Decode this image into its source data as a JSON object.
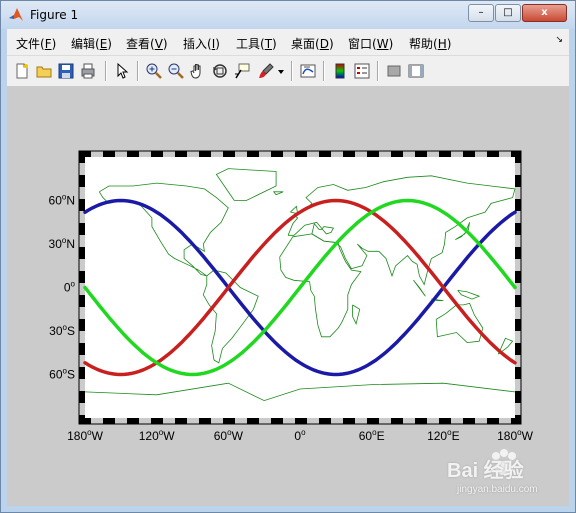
{
  "window": {
    "title": "Figure 1"
  },
  "window_controls": {
    "minimize": "–",
    "maximize": "□",
    "close": "x"
  },
  "menu": {
    "items": [
      {
        "label": "文件(",
        "key": "F",
        "end": ")"
      },
      {
        "label": "编辑(",
        "key": "E",
        "end": ")"
      },
      {
        "label": "查看(",
        "key": "V",
        "end": ")"
      },
      {
        "label": "插入(",
        "key": "I",
        "end": ")"
      },
      {
        "label": "工具(",
        "key": "T",
        "end": ")"
      },
      {
        "label": "桌面(",
        "key": "D",
        "end": ")"
      },
      {
        "label": "窗口(",
        "key": "W",
        "end": ")"
      },
      {
        "label": "帮助(",
        "key": "H",
        "end": ")"
      }
    ],
    "dock_arrow": "↘"
  },
  "toolbar": {
    "buttons": [
      "new-figure-icon",
      "open-file-icon",
      "save-icon",
      "print-icon",
      "edit-plot-arrow-icon",
      "zoom-in-icon",
      "zoom-out-icon",
      "pan-hand-icon",
      "rotate-3d-icon",
      "data-cursor-icon",
      "brush-icon",
      "brush-dropdown-icon",
      "link-plot-icon",
      "colorbar-icon",
      "legend-icon",
      "hide-plot-tools-icon",
      "show-plot-tools-icon"
    ]
  },
  "chart_data": {
    "type": "line",
    "projection": "equidistant cylindrical (world map)",
    "xlim": [
      -180,
      180
    ],
    "ylim": [
      -90,
      90
    ],
    "x_ticks": [
      {
        "value": -180,
        "label_num": "180",
        "label_dir": "W"
      },
      {
        "value": -120,
        "label_num": "120",
        "label_dir": "W"
      },
      {
        "value": -60,
        "label_num": "60",
        "label_dir": "W"
      },
      {
        "value": 0,
        "label_num": "0",
        "label_dir": ""
      },
      {
        "value": 60,
        "label_num": "60",
        "label_dir": "E"
      },
      {
        "value": 120,
        "label_num": "120",
        "label_dir": "E"
      },
      {
        "value": 180,
        "label_num": "180",
        "label_dir": "W"
      }
    ],
    "y_ticks": [
      {
        "value": 60,
        "label_num": "60",
        "label_dir": "N"
      },
      {
        "value": 30,
        "label_num": "30",
        "label_dir": "N"
      },
      {
        "value": 0,
        "label_num": "0",
        "label_dir": ""
      },
      {
        "value": -30,
        "label_num": "30",
        "label_dir": "S"
      },
      {
        "value": -60,
        "label_num": "60",
        "label_dir": "S"
      }
    ],
    "series": [
      {
        "color": "#1a1aa6",
        "amplitude": 60,
        "peak_lon": -150
      },
      {
        "color": "#c8201e",
        "amplitude": 60,
        "peak_lon": 30
      },
      {
        "color": "#20d820",
        "amplitude": 60,
        "peak_lon": 90
      }
    ],
    "coastline_color": "#1a8a1a",
    "frame": "black-white dashed border"
  },
  "watermark": {
    "brand": "Bai 经验",
    "url": "jingyan.baidu.com"
  }
}
